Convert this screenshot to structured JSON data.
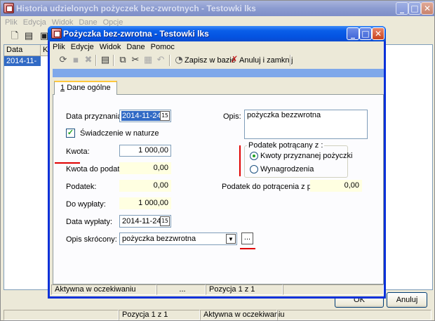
{
  "back_window": {
    "title": "Historia udzielonych pożyczek bez-zwrotnych - Testowki lks",
    "menu": [
      "Plik",
      "Edycja",
      "Widok",
      "Dane",
      "Opcje"
    ],
    "list": {
      "columns": [
        "Data przy...",
        "Kw"
      ],
      "rows": [
        {
          "date": "2014-11-24"
        }
      ]
    },
    "ok_label": "OK",
    "cancel_label": "Anuluj",
    "status": {
      "position": "Pozycja 1 z 1",
      "state": "Aktywna w oczekiwaniu"
    }
  },
  "dialog": {
    "title": "Pożyczka bez-zwrotna - Testowki lks",
    "menu": [
      "Plik",
      "Edycje",
      "Widok",
      "Dane",
      "Pomoc"
    ],
    "toolbar": {
      "save_label": "Zapisz w bazie",
      "cancel_close_label": "Anuluj i zamknij"
    },
    "tab_label": "Dane ogólne",
    "tab_shortcut": "1",
    "form": {
      "data_przyznania_label": "Data przyznania:",
      "data_przyznania_value": "2014-11-24",
      "swiadczenie_label": "Świadczenie w naturze",
      "swiadczenie_checked": true,
      "kwota_label": "Kwota:",
      "kwota_value": "1 000,00",
      "kwota_do_podatku_label": "Kwota do podatku:",
      "kwota_do_podatku_value": "0,00",
      "podatek_label": "Podatek:",
      "podatek_value": "0,00",
      "do_wyplaty_label": "Do wypłaty:",
      "do_wyplaty_value": "1 000,00",
      "data_wyplaty_label": "Data wypłaty:",
      "data_wyplaty_value": "2014-11-24",
      "opis_skrocony_label": "Opis skrócony:",
      "opis_skrocony_value": "pożyczka bezzwrotna",
      "ellipsis_label": "...",
      "opis_label": "Opis:",
      "opis_value": "pożyczka bezzwrotna",
      "podatek_group_title": "Podatek potrącany z :",
      "radio_options": [
        {
          "label": "Kwoty przyznanej pożyczki",
          "selected": true
        },
        {
          "label": "Wynagrodzenia",
          "selected": false
        }
      ],
      "podatek_z_plac_label": "Podatek do potrącenia z płac:",
      "podatek_z_plac_value": "0,00"
    },
    "status": {
      "state": "Aktywna w oczekiwaniu",
      "ellipsis": "...",
      "position": "Pozycja 1 z 1"
    }
  },
  "colors": {
    "titlebar_active": "#0a5ee9",
    "highlight_red": "#e00000",
    "readonly_yellow": "#ffffe1",
    "selection_blue": "#316ac5"
  }
}
